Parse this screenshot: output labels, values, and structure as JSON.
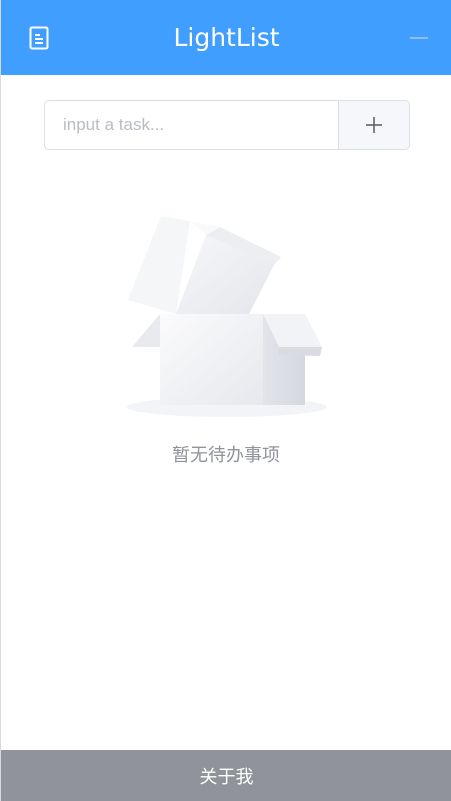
{
  "header": {
    "title": "LightList",
    "menu_icon": "document-list-icon",
    "minimize_icon": "minimize-icon",
    "background_color": "#409eff"
  },
  "task_input": {
    "placeholder": "input a task...",
    "value": ""
  },
  "add_button": {
    "icon": "plus-icon"
  },
  "empty_state": {
    "icon": "empty-box-icon",
    "text": "暂无待办事项"
  },
  "footer": {
    "label": "关于我",
    "background_color": "#909399"
  }
}
